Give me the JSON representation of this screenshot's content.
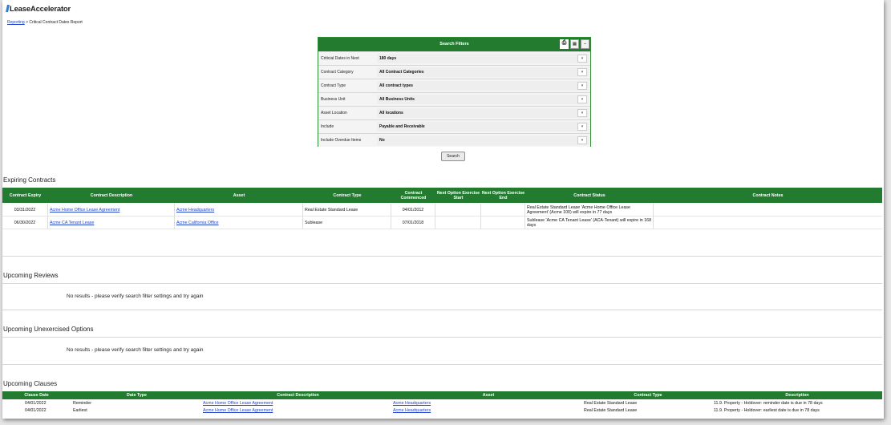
{
  "app": {
    "logo_text": "LeaseAccelerator"
  },
  "breadcrumb": {
    "link": "Reporting",
    "separator": " > ",
    "current": "Critical Contract Dates Report"
  },
  "filters": {
    "title": "Search Filters",
    "rows": [
      {
        "label": "Criticial Dates in Next",
        "value": "180 days"
      },
      {
        "label": "Contract Category",
        "value": "All Contract Categories"
      },
      {
        "label": "Contract Type",
        "value": "All contract types"
      },
      {
        "label": "Business Unit",
        "value": "All Business Units"
      },
      {
        "label": "Asset Location",
        "value": "All locations"
      },
      {
        "label": "Include",
        "value": "Payable and Receivable"
      },
      {
        "label": "Include Overdue Items",
        "value": "No"
      }
    ],
    "search_button": "Search"
  },
  "expiring": {
    "title": "Expiring Contracts",
    "headers": [
      "Contract Expiry",
      "Contract Description",
      "Asset",
      "Contract Type",
      "Contract Commenced",
      "Next Option Exercise Start",
      "Next Option Exercise End",
      "Contract Status",
      "Contract Notes"
    ],
    "rows": [
      {
        "expiry": "03/31/2022",
        "description": "Acme Home Office Lease Agreement",
        "asset": "Acme Headquarters",
        "type": "Real Estate Standard Lease",
        "commenced": "04/01/2012",
        "opt_start": "",
        "opt_end": "",
        "status": "Real Estate Standard Lease 'Acme Home Office Lease Agreement' (Acme 100) will expire in 77 days",
        "notes": ""
      },
      {
        "expiry": "06/30/2022",
        "description": "Acme CA Tenant Lease",
        "asset": "Acme California Office",
        "type": "Sublease",
        "commenced": "07/01/2018",
        "opt_start": "",
        "opt_end": "",
        "status": "Sublease 'Acme CA Tenant Lease' (ACA-Tenant) will expire in 168 days",
        "notes": ""
      }
    ]
  },
  "reviews": {
    "title": "Upcoming Reviews",
    "empty_message": "No results - please verify search filter settings and try again"
  },
  "options": {
    "title": "Upcoming Unexercised Options",
    "empty_message": "No results - please verify search filter settings and try again"
  },
  "clauses": {
    "title": "Upcoming Clauses",
    "headers": [
      "Clause Date",
      "Date Type",
      "Contract Description",
      "Asset",
      "Contract Type",
      "Description"
    ],
    "rows": [
      {
        "date": "04/01/2022",
        "date_type": "Reminder",
        "description": "Acme Home Office Lease Agreement",
        "asset": "Acme Headquarters",
        "type": "Real Estate Standard Lease",
        "clause": "11.9. Property - Holdover: reminder date is due in 78 days"
      },
      {
        "date": "04/01/2022",
        "date_type": "Earliest",
        "description": "Acme Home Office Lease Agreement",
        "asset": "Acme Headquarters",
        "type": "Real Estate Standard Lease",
        "clause": "11.9. Property - Holdover: earliest date is due in 78 days"
      }
    ]
  },
  "colors": {
    "header_green": "#237b2f",
    "link_blue": "#2244cc",
    "logo_accent": "#2f80c8"
  },
  "icons": [
    "print-icon",
    "export-excel-icon",
    "collapse-icon",
    "dropdown-caret-icon"
  ]
}
